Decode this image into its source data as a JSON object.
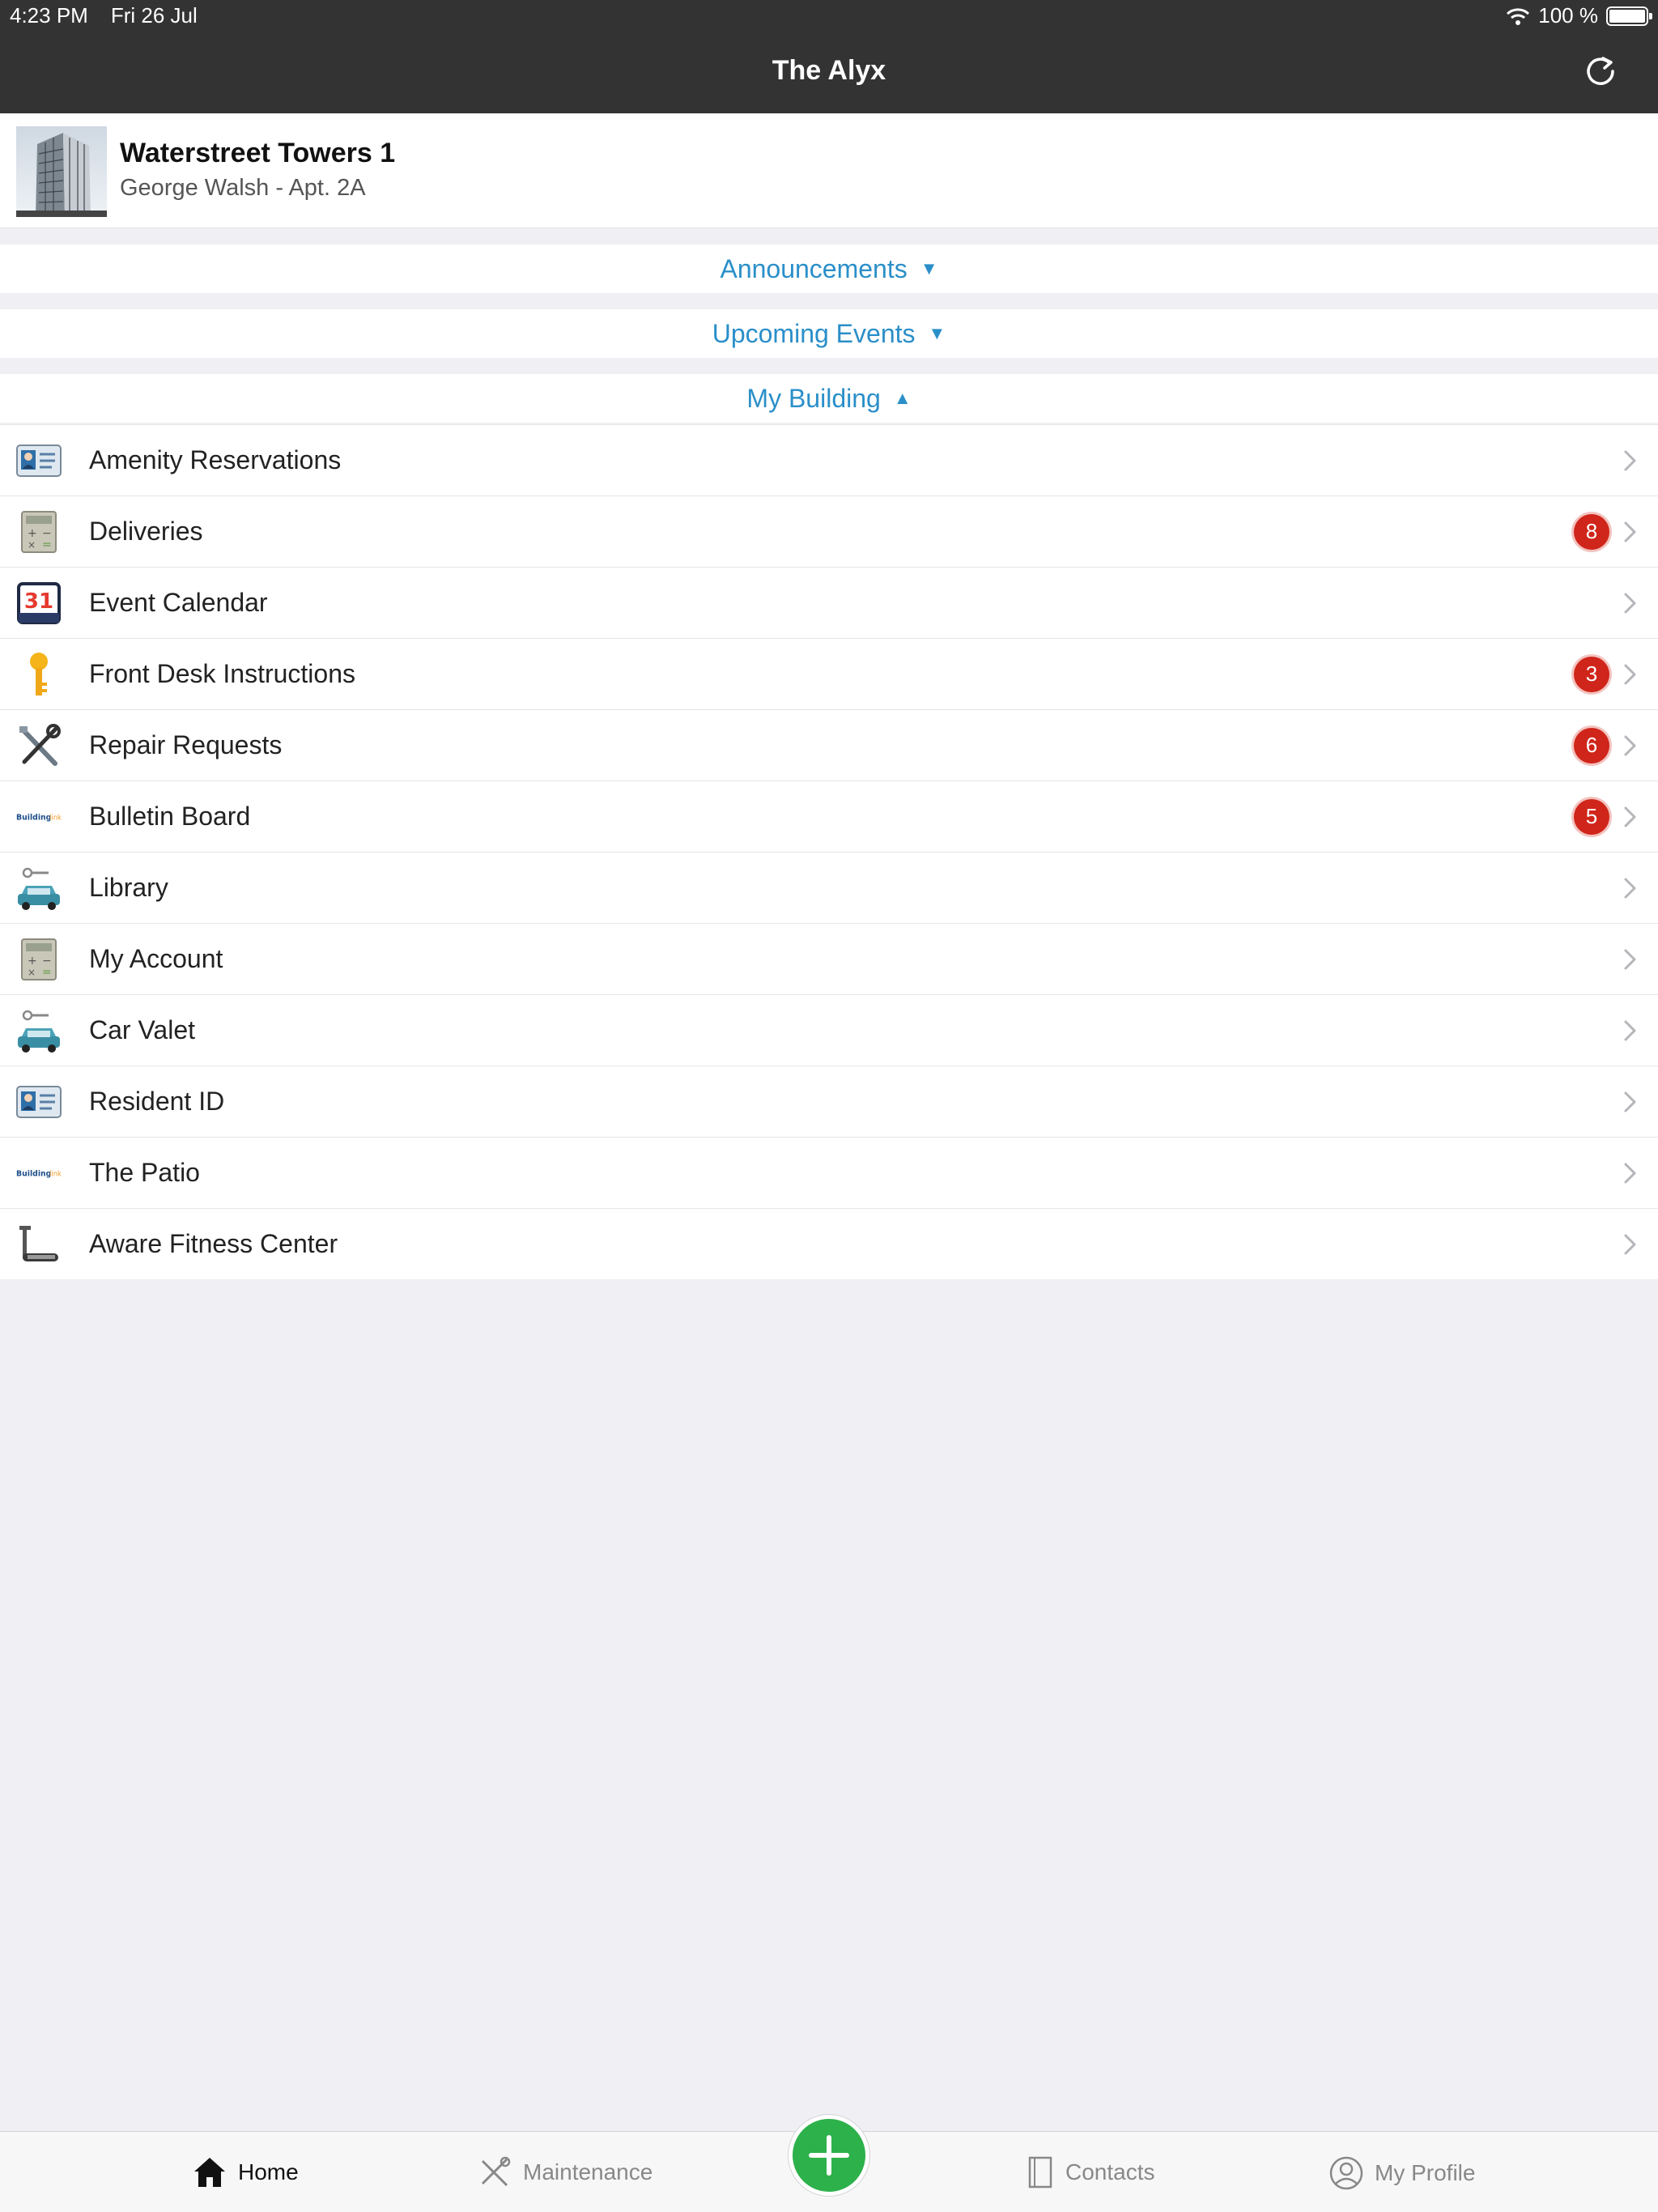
{
  "status": {
    "time": "4:23 PM",
    "date": "Fri 26 Jul",
    "battery": "100 %",
    "battery_level": 1.0
  },
  "nav": {
    "title": "The Alyx",
    "refresh_icon": "refresh-icon"
  },
  "building": {
    "name": "Waterstreet Towers 1",
    "resident": "George Walsh - Apt.  2A"
  },
  "sections": {
    "announcements": {
      "label": "Announcements",
      "arrow": "▼"
    },
    "upcoming": {
      "label": "Upcoming Events",
      "arrow": "▼"
    },
    "my_building": {
      "label": "My Building",
      "arrow": "▲"
    }
  },
  "items": [
    {
      "label": "Amenity Reservations",
      "icon": "id-card-icon",
      "badge": null
    },
    {
      "label": "Deliveries",
      "icon": "calculator-icon",
      "badge": "8"
    },
    {
      "label": "Event Calendar",
      "icon": "calendar-icon",
      "badge": null,
      "cal_day": "31"
    },
    {
      "label": "Front Desk Instructions",
      "icon": "key-icon",
      "badge": "3"
    },
    {
      "label": "Repair Requests",
      "icon": "tools-icon",
      "badge": "6"
    },
    {
      "label": "Bulletin Board",
      "icon": "buildinglink-logo-icon",
      "badge": "5"
    },
    {
      "label": "Library",
      "icon": "car-key-icon",
      "badge": null
    },
    {
      "label": "My Account",
      "icon": "calculator-icon",
      "badge": null
    },
    {
      "label": "Car Valet",
      "icon": "car-key-icon",
      "badge": null
    },
    {
      "label": "Resident ID",
      "icon": "id-card-icon",
      "badge": null
    },
    {
      "label": "The Patio",
      "icon": "buildinglink-logo-icon",
      "badge": null
    },
    {
      "label": "Aware Fitness Center",
      "icon": "treadmill-icon",
      "badge": null
    }
  ],
  "tabs": {
    "home": "Home",
    "maintenance": "Maintenance",
    "contacts": "Contacts",
    "profile": "My Profile"
  },
  "colors": {
    "accent": "#2a8fc9",
    "badge": "#d0251a",
    "fab": "#2db14b",
    "navbar": "#333333"
  }
}
